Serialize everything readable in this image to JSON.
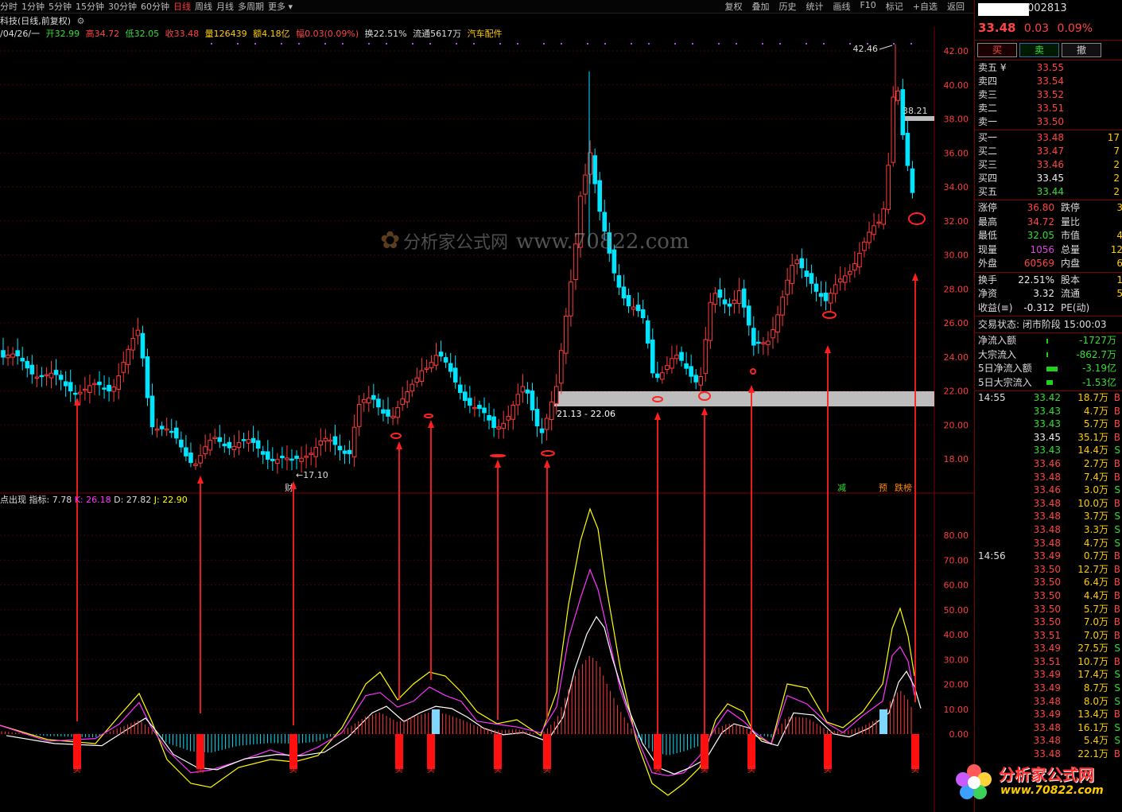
{
  "periods": [
    "分时",
    "1分钟",
    "5分钟",
    "15分钟",
    "30分钟",
    "60分钟",
    "日线",
    "周线",
    "月线",
    "多周期",
    "更多 ▾"
  ],
  "active_period": "日线",
  "tools": [
    "复权",
    "叠加",
    "历史",
    "统计",
    "画线",
    "F10",
    "标记",
    "+自选",
    "返回"
  ],
  "stock": {
    "title": "科技(日线,前复权)",
    "date": "/04/26/一",
    "open": "开32.99",
    "high": "高34.72",
    "low": "低32.05",
    "close": "收33.48",
    "vol": "量126439",
    "amount": "额4.18亿",
    "change": "幅0.03(0.09%)",
    "turnover": "换22.51%",
    "float": "流通5617万",
    "sector": "汽车配件"
  },
  "chart_data": {
    "type": "candlestick",
    "main_axis": [
      "42.00",
      "40.00",
      "38.00",
      "36.00",
      "34.00",
      "32.00",
      "30.00",
      "28.00",
      "26.00",
      "24.00",
      "22.00",
      "20.00",
      "18.00"
    ],
    "sub_axis": [
      "80.00",
      "70.00",
      "60.00",
      "50.00",
      "40.00",
      "30.00",
      "20.00",
      "10.00",
      "0.00"
    ],
    "annotations": {
      "high_label": "42.46",
      "mid_label": "38.21",
      "low_label": "←17.10",
      "zone_label": "21.13 - 22.06",
      "cai": "财",
      "jian": "减",
      "yu": "预",
      "die": "跌榜",
      "buy_mark": "买"
    },
    "indicator": {
      "name": "点出现",
      "index": "指标: 7.78",
      "k": "K: 26.18",
      "d": "D: 27.82",
      "j": "J: 22.90"
    },
    "colors": {
      "up": "#ff3b3b",
      "down": "#00e5ff",
      "k": "#ffffff",
      "d": "#ff33ff",
      "j": "#ffff00",
      "zone": "#bdbdbd"
    }
  },
  "watermark": {
    "text1": "分析家公式网",
    "text2": "www.70822.com",
    "url_big": "www.70822.com"
  },
  "quote": {
    "code": "002813",
    "price": "33.48",
    "chg": "0.03",
    "pct": "0.09%",
    "buttons": [
      "买",
      "卖",
      "撤"
    ],
    "sells": [
      {
        "n": "卖五 ¥",
        "p": "33.55",
        "v": ""
      },
      {
        "n": "卖四",
        "p": "33.54",
        "v": ""
      },
      {
        "n": "卖三",
        "p": "33.52",
        "v": ""
      },
      {
        "n": "卖二",
        "p": "33.51",
        "v": ""
      },
      {
        "n": "卖一",
        "p": "33.50",
        "v": ""
      }
    ],
    "buys": [
      {
        "n": "买一",
        "p": "33.48",
        "v": "17",
        "c": "red"
      },
      {
        "n": "买二",
        "p": "33.47",
        "v": "7",
        "c": "red"
      },
      {
        "n": "买三",
        "p": "33.46",
        "v": "2",
        "c": "red"
      },
      {
        "n": "买四",
        "p": "33.45",
        "v": "2",
        "c": "white"
      },
      {
        "n": "买五",
        "p": "33.44",
        "v": "2",
        "c": "green"
      }
    ],
    "stats": [
      {
        "k": "涨停",
        "v": "36.80",
        "vc": "red",
        "k2": "跌停",
        "v2": "3"
      },
      {
        "k": "最高",
        "v": "34.72",
        "vc": "red",
        "k2": "量比",
        "v2": ""
      },
      {
        "k": "最低",
        "v": "32.05",
        "vc": "green",
        "k2": "市值",
        "v2": "4"
      },
      {
        "k": "现量",
        "v": "1056",
        "vc": "magenta",
        "k2": "总量",
        "v2": "12"
      },
      {
        "k": "外盘",
        "v": "60569",
        "vc": "red",
        "k2": "内盘",
        "v2": "6"
      }
    ],
    "stats2": [
      {
        "k": "换手",
        "v": "22.51%",
        "vc": "white",
        "k2": "股本",
        "v2": "1"
      },
      {
        "k": "净资",
        "v": "3.32",
        "vc": "white",
        "k2": "流通",
        "v2": "5"
      },
      {
        "k": "收益(≡)",
        "v": "-0.312",
        "vc": "white",
        "k2": "PE(动)",
        "v2": ""
      }
    ],
    "status": "交易状态: 闭市阶段 15:00:03",
    "flows": [
      {
        "k": "净流入额",
        "v": "-1727万",
        "w": 2
      },
      {
        "k": "大宗流入",
        "v": "-862.7万",
        "w": 2
      },
      {
        "k": "5日净流入额",
        "v": "-3.19亿",
        "w": 14
      },
      {
        "k": "5日大宗流入",
        "v": "-1.53亿",
        "w": 8
      }
    ],
    "ticks": [
      {
        "t": "14:55",
        "p": "33.42",
        "pc": "green",
        "v": "18.7万",
        "s": "B"
      },
      {
        "t": "",
        "p": "33.43",
        "pc": "green",
        "v": "4.7万",
        "s": "B"
      },
      {
        "t": "",
        "p": "33.43",
        "pc": "green",
        "v": "5.7万",
        "s": "B"
      },
      {
        "t": "",
        "p": "33.45",
        "pc": "white",
        "v": "35.1万",
        "s": "B"
      },
      {
        "t": "",
        "p": "33.43",
        "pc": "green",
        "v": "14.4万",
        "s": "S"
      },
      {
        "t": "",
        "p": "33.46",
        "pc": "red",
        "v": "2.7万",
        "s": "B"
      },
      {
        "t": "",
        "p": "33.48",
        "pc": "red",
        "v": "7.4万",
        "s": "B"
      },
      {
        "t": "",
        "p": "33.46",
        "pc": "red",
        "v": "3.0万",
        "s": "S"
      },
      {
        "t": "",
        "p": "33.48",
        "pc": "red",
        "v": "10.0万",
        "s": "B"
      },
      {
        "t": "",
        "p": "33.48",
        "pc": "red",
        "v": "3.7万",
        "s": "S"
      },
      {
        "t": "",
        "p": "33.48",
        "pc": "red",
        "v": "3.3万",
        "s": "S"
      },
      {
        "t": "",
        "p": "33.48",
        "pc": "red",
        "v": "4.7万",
        "s": "S"
      },
      {
        "t": "14:56",
        "p": "33.49",
        "pc": "red",
        "v": "0.7万",
        "s": "B"
      },
      {
        "t": "",
        "p": "33.50",
        "pc": "red",
        "v": "12.7万",
        "s": "B"
      },
      {
        "t": "",
        "p": "33.50",
        "pc": "red",
        "v": "6.4万",
        "s": "B"
      },
      {
        "t": "",
        "p": "33.50",
        "pc": "red",
        "v": "4.4万",
        "s": "B"
      },
      {
        "t": "",
        "p": "33.50",
        "pc": "red",
        "v": "5.7万",
        "s": "B"
      },
      {
        "t": "",
        "p": "33.50",
        "pc": "red",
        "v": "7.0万",
        "s": "B"
      },
      {
        "t": "",
        "p": "33.51",
        "pc": "red",
        "v": "7.0万",
        "s": "B"
      },
      {
        "t": "",
        "p": "33.49",
        "pc": "red",
        "v": "27.5万",
        "s": "S"
      },
      {
        "t": "",
        "p": "33.51",
        "pc": "red",
        "v": "10.7万",
        "s": "B"
      },
      {
        "t": "",
        "p": "33.49",
        "pc": "red",
        "v": "17.4万",
        "s": "S"
      },
      {
        "t": "",
        "p": "33.49",
        "pc": "red",
        "v": "8.7万",
        "s": "S"
      },
      {
        "t": "",
        "p": "33.48",
        "pc": "red",
        "v": "8.0万",
        "s": "S"
      },
      {
        "t": "",
        "p": "33.49",
        "pc": "red",
        "v": "13.4万",
        "s": "B"
      },
      {
        "t": "",
        "p": "33.48",
        "pc": "red",
        "v": "16.1万",
        "s": "S"
      },
      {
        "t": "",
        "p": "33.48",
        "pc": "red",
        "v": "5.4万",
        "s": "S"
      },
      {
        "t": "",
        "p": "33.48",
        "pc": "red",
        "v": "22.1万",
        "s": "B"
      }
    ]
  }
}
